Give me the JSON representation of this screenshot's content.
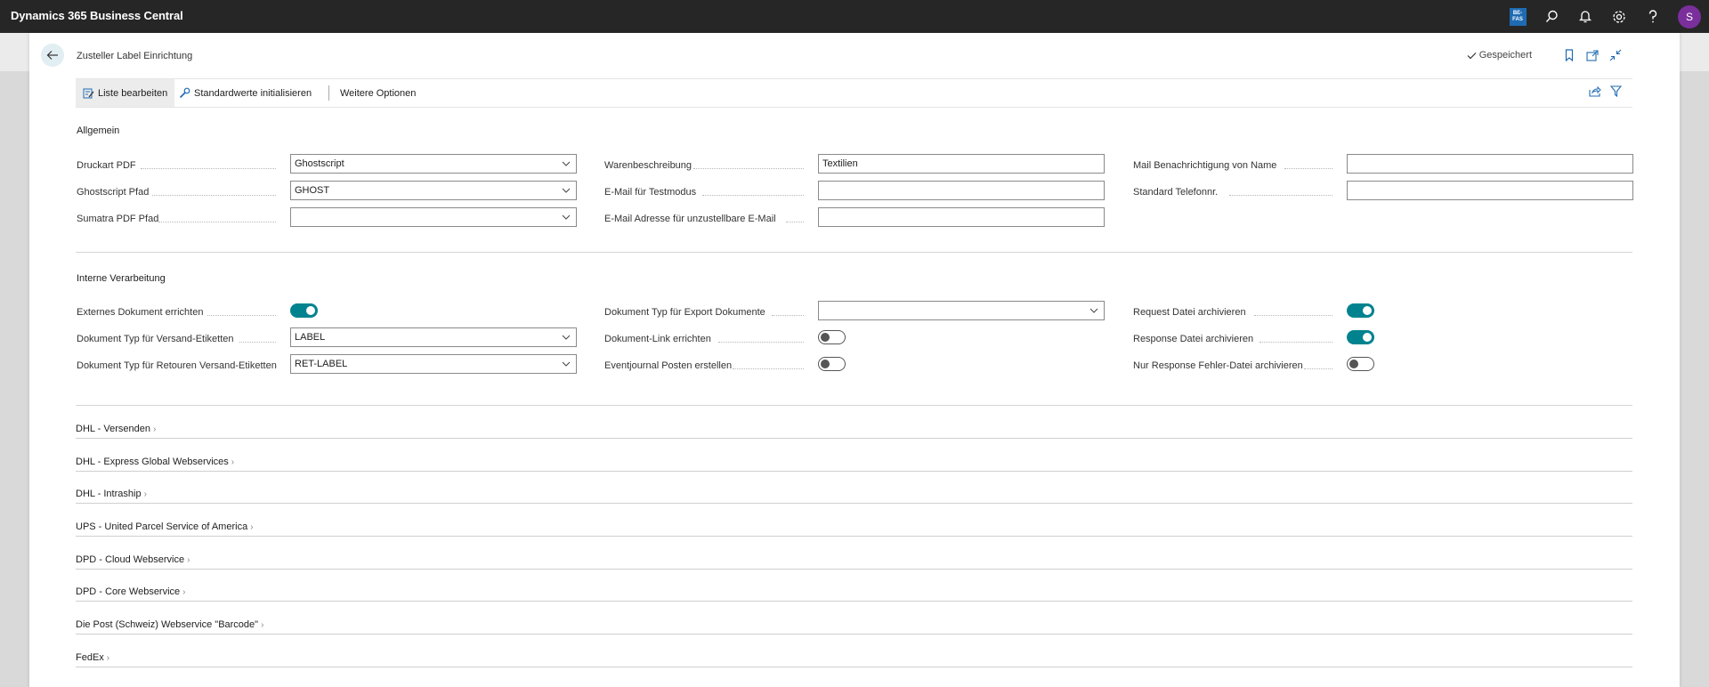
{
  "app": {
    "title": "Dynamics 365 Business Central",
    "badge_top": "BE-",
    "badge_bottom": "FAS",
    "avatar": "S"
  },
  "page": {
    "title": "Zusteller Label Einrichtung",
    "saved": "Gespeichert"
  },
  "actions": {
    "edit_list": "Liste bearbeiten",
    "init_defaults": "Standardwerte initialisieren",
    "more_options": "Weitere Optionen"
  },
  "general": {
    "title": "Allgemein",
    "druckart_label": "Druckart PDF",
    "druckart_value": "Ghostscript",
    "ghostscript_label": "Ghostscript Pfad",
    "ghostscript_value": "GHOST",
    "sumatra_label": "Sumatra PDF Pfad",
    "sumatra_value": "",
    "waren_label": "Warenbeschreibung",
    "waren_value": "Textilien",
    "email_test_label": "E-Mail für Testmodus",
    "email_test_value": "",
    "email_undeliv_label": "E-Mail Adresse für unzustellbare E-Mail",
    "email_undeliv_value": "",
    "mail_name_label": "Mail Benachrichtigung von Name",
    "mail_name_value": "",
    "phone_label": "Standard Telefonnr.",
    "phone_value": ""
  },
  "internal": {
    "title": "Interne Verarbeitung",
    "ext_doc_label": "Externes Dokument errichten",
    "ext_doc_on": true,
    "doc_type_ship_label": "Dokument Typ für Versand-Etiketten",
    "doc_type_ship_value": "LABEL",
    "doc_type_return_label": "Dokument Typ für Retouren Versand-Etiketten",
    "doc_type_return_value": "RET-LABEL",
    "doc_type_export_label": "Dokument Typ für Export Dokumente",
    "doc_type_export_value": "",
    "doc_link_label": "Dokument-Link errichten",
    "doc_link_on": false,
    "event_journal_label": "Eventjournal Posten erstellen",
    "event_journal_on": false,
    "request_archive_label": "Request Datei archivieren",
    "request_archive_on": true,
    "response_archive_label": "Response Datei archivieren",
    "response_archive_on": true,
    "response_error_label": "Nur Response Fehler-Datei archivieren",
    "response_error_on": false
  },
  "groups": [
    "DHL - Versenden",
    "DHL - Express Global Webservices",
    "DHL - Intraship",
    "UPS - United Parcel Service of America",
    "DPD - Cloud Webservice",
    "DPD - Core Webservice",
    "Die Post (Schweiz) Webservice \"Barcode\"",
    "FedEx"
  ],
  "colors": {
    "topbar": "#262626",
    "accent": "#00838f",
    "avatar": "#7a2f9c",
    "badge": "#1f6bb3"
  }
}
